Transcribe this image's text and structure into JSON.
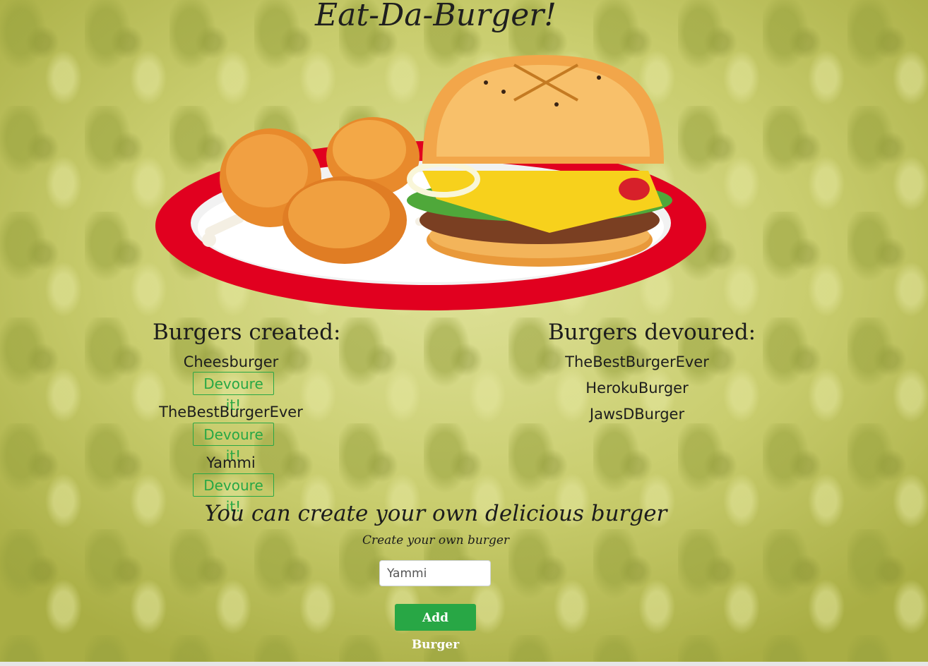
{
  "header": {
    "title": "Eat-Da-Burger!"
  },
  "created": {
    "heading": "Burgers created:",
    "items": [
      {
        "name": "Cheesburger",
        "button": "Devoure it!"
      },
      {
        "name": "TheBestBurgerEver",
        "button": "Devoure it!"
      },
      {
        "name": "Yammi",
        "button": "Devoure it!"
      }
    ]
  },
  "devoured": {
    "heading": "Burgers devoured:",
    "items": [
      "TheBestBurgerEver",
      "HerokuBurger",
      "JawsDBurger"
    ]
  },
  "form": {
    "heading": "You can create your own delicious burger",
    "label": "Create your own burger",
    "input_value": "Yammi",
    "submit_label": "Add Burger"
  },
  "colors": {
    "accent_green": "#28a745",
    "plate_red": "#e1001f"
  },
  "icons": {
    "hero_image": "burger-and-chicken-plate-illustration"
  }
}
